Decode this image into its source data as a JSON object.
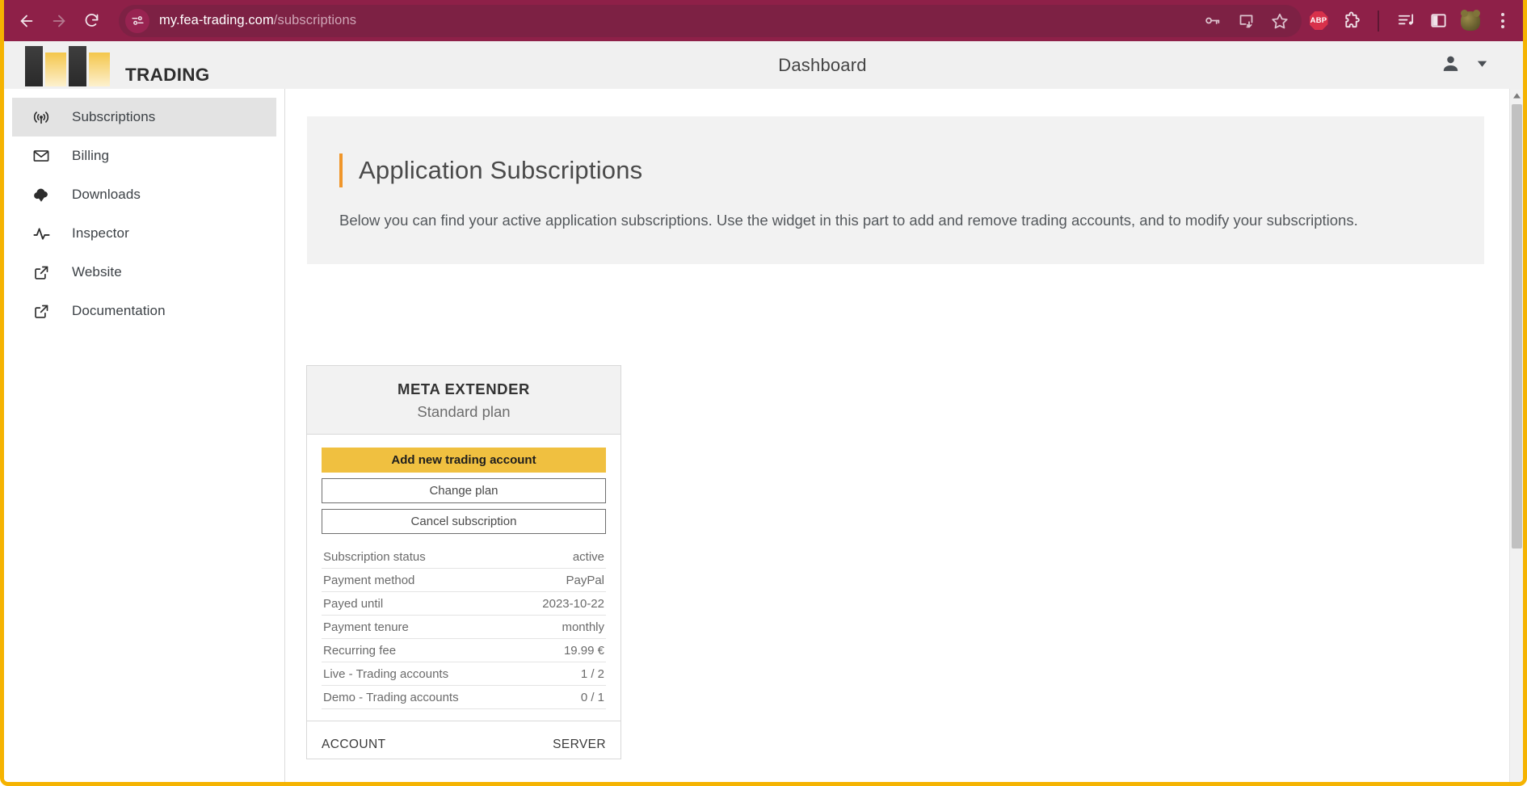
{
  "browser": {
    "back_label": "Back",
    "forward_label": "Forward",
    "reload_label": "Reload",
    "site_info_label": "View site information",
    "url_host": "my.fea-trading.com",
    "url_path": "/subscriptions",
    "pill_icons": [
      {
        "name": "password-key-icon",
        "label": "Saved passwords"
      },
      {
        "name": "install-app-icon",
        "label": "Install app"
      },
      {
        "name": "bookmark-star-icon",
        "label": "Bookmark this tab"
      }
    ],
    "extensions": [
      {
        "name": "adblock-plus-icon",
        "label": "ABP"
      },
      {
        "name": "extensions-puzzle-icon",
        "label": "Extensions"
      },
      {
        "name": "media-playlist-icon",
        "label": "Media controls"
      },
      {
        "name": "side-panel-icon",
        "label": "Side panel"
      },
      {
        "name": "frog-extension-icon",
        "label": "Extension"
      },
      {
        "name": "chrome-menu-icon",
        "label": "Customize and control"
      }
    ]
  },
  "app": {
    "logo_text": "TRADING",
    "header_title": "Dashboard",
    "account_menu_label": "Account menu"
  },
  "sidebar": {
    "items": [
      {
        "label": "Subscriptions",
        "icon": "broadcast-icon",
        "active": true
      },
      {
        "label": "Billing",
        "icon": "envelope-icon",
        "active": false
      },
      {
        "label": "Downloads",
        "icon": "cloud-download-icon",
        "active": false
      },
      {
        "label": "Inspector",
        "icon": "activity-pulse-icon",
        "active": false
      },
      {
        "label": "Website",
        "icon": "external-link-icon",
        "active": false
      },
      {
        "label": "Documentation",
        "icon": "external-link-icon",
        "active": false
      }
    ]
  },
  "main": {
    "intro": {
      "title": "Application Subscriptions",
      "body": "Below you can find your active application subscriptions. Use the widget in this part to add and remove trading accounts, and to modify your subscriptions."
    },
    "subscription_card": {
      "app_name": "META EXTENDER",
      "plan_name": "Standard plan",
      "buttons": [
        {
          "label": "Add new trading account",
          "style": "primary"
        },
        {
          "label": "Change plan",
          "style": "outline"
        },
        {
          "label": "Cancel subscription",
          "style": "outline"
        }
      ],
      "details": [
        {
          "label": "Subscription status",
          "value": "active"
        },
        {
          "label": "Payment method",
          "value": "PayPal"
        },
        {
          "label": "Payed until",
          "value": "2023-10-22"
        },
        {
          "label": "Payment tenure",
          "value": "monthly"
        },
        {
          "label": "Recurring fee",
          "value": "19.99 €"
        },
        {
          "label": "Live - Trading accounts",
          "value": "1 / 2"
        },
        {
          "label": "Demo - Trading accounts",
          "value": "0 / 1"
        }
      ],
      "accounts_table": {
        "col_account": "ACCOUNT",
        "col_server": "SERVER"
      }
    }
  },
  "colors": {
    "browser_bar": "#8e2048",
    "window_border": "#f5b301",
    "brand_yellow": "#f0c040",
    "accent_orange": "#f0962a",
    "sidebar_active": "#e3e3e3"
  }
}
